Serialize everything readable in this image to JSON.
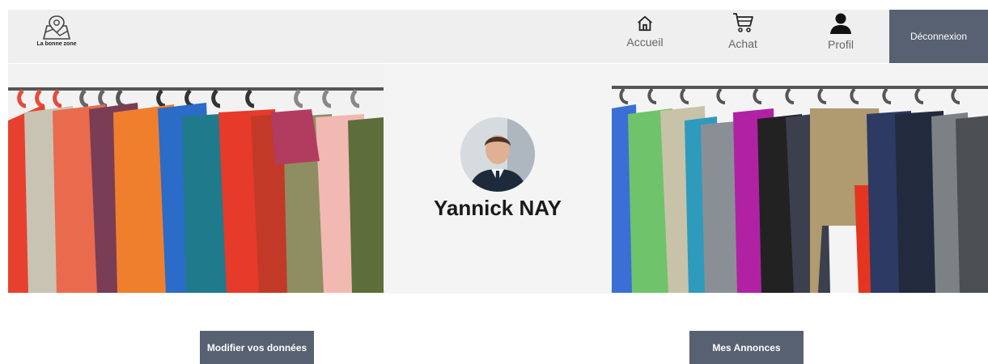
{
  "header": {
    "logo_text": "La bonne zone",
    "logout_label": "Déconnexion",
    "nav": [
      {
        "label": "Accueil",
        "icon": "home-icon"
      },
      {
        "label": "Achat",
        "icon": "cart-icon"
      },
      {
        "label": "Profil",
        "icon": "user-icon"
      }
    ]
  },
  "profile": {
    "name": "Yannick NAY"
  },
  "actions": {
    "edit_label": "Modifier vos données",
    "ads_label": "Mes Annonces"
  },
  "colors": {
    "accent": "#586171",
    "header_bg": "#efefef",
    "card_bg": "#f4f4f4"
  }
}
